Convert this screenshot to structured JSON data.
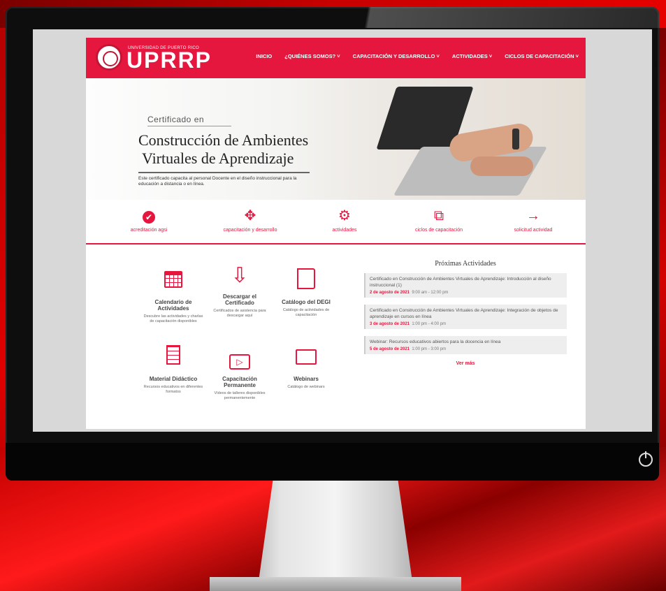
{
  "site": {
    "logo_small": "UNIVERSIDAD DE PUERTO RICO",
    "logo_text": "UPRRP"
  },
  "nav": {
    "items": [
      {
        "label": "INICIO"
      },
      {
        "label": "¿QUIÉNES SOMOS? ˅"
      },
      {
        "label": "CAPACITACIÓN Y DESARROLLO ˅"
      },
      {
        "label": "ACTIVIDADES ˅"
      },
      {
        "label": "CICLOS DE CAPACITACIÓN ˅"
      }
    ]
  },
  "hero": {
    "kicker": "Certificado en",
    "title_line1": "Construcción de Ambientes",
    "title_line2": "Virtuales de Aprendizaje",
    "description": "Este certificado capacita al personal Docente en el diseño instruccional para la educación a distancia o en línea."
  },
  "icon_bar": [
    {
      "icon": "check-circle-icon",
      "glyph": "✔",
      "label": "acreditación agsi"
    },
    {
      "icon": "move-icon",
      "glyph": "✥",
      "label": "capacitación y desarrollo"
    },
    {
      "icon": "gears-icon",
      "glyph": "⚙",
      "label": "actividades"
    },
    {
      "icon": "projector-icon",
      "glyph": "⧉",
      "label": "ciclos de capacitación"
    },
    {
      "icon": "arrow-right-icon",
      "glyph": "→",
      "label": "solicitud actividad"
    }
  ],
  "services": [
    {
      "title": "Calendario de Actividades",
      "desc": "Descubre las actividades y charlas de capacitación disponibles",
      "icon": "calendar-icon"
    },
    {
      "title": "Descargar el Certificado",
      "desc": "Certificados de asistencia para descargar aquí",
      "icon": "download-icon"
    },
    {
      "title": "Catálogo del DEGI",
      "desc": "Catálogo de actividades de capacitación",
      "icon": "book-icon"
    },
    {
      "title": "Material Didáctico",
      "desc": "Recursos educativos en diferentes formatos",
      "icon": "document-icon"
    },
    {
      "title": "Capacitación Permanente",
      "desc": "Vídeos de talleres disponibles permanentemente",
      "icon": "play-icon"
    },
    {
      "title": "Webinars",
      "desc": "Catálogo de webinars",
      "icon": "webinar-icon"
    }
  ],
  "activities": {
    "title": "Próximas Actividades",
    "items": [
      {
        "text": "Certificado en Construcción de Ambientes Virtuales de Aprendizaje: Introducción al diseño instruccional (1)",
        "date": "2 de agosto de 2021",
        "time": "9:00 am - 12:00 pm"
      },
      {
        "text": "Certificado en Construcción de Ambientes Virtuales de Aprendizaje: Integración de objetos de aprendizaje en cursos en línea",
        "date": "3 de agosto de 2021",
        "time": "1:00 pm - 4:00 pm"
      },
      {
        "text": "Webinar: Recursos educativos abiertos para la docencia en línea",
        "date": "5 de agosto de 2021",
        "time": "1:00 pm - 3:00 pm"
      }
    ],
    "more": "Ver más"
  },
  "colors": {
    "brand": "#e5173f"
  }
}
